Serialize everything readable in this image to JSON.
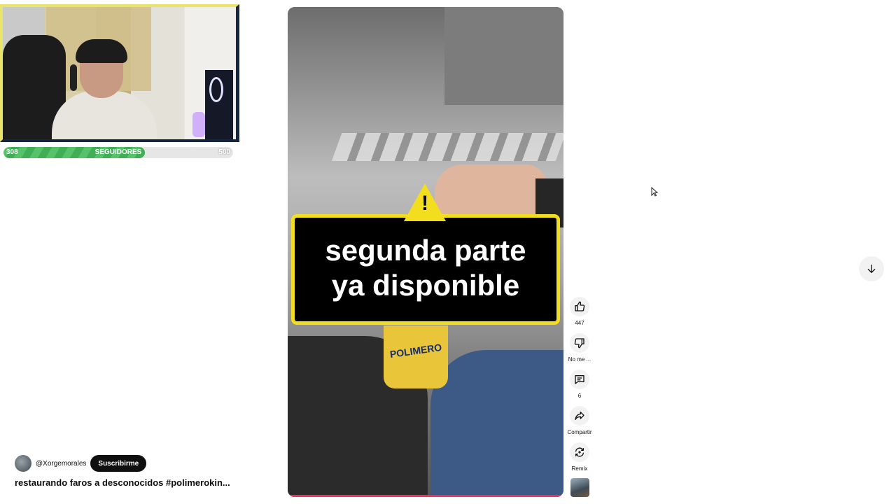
{
  "follower_goal": {
    "current": "308",
    "label": "SEGUIDORES",
    "target": "500",
    "progress_fraction": 0.616,
    "fill_color": "#4cb862"
  },
  "video": {
    "banner_line1": "segunda parte",
    "banner_line2": "ya disponible",
    "can_text": "POLIMERO",
    "progress_color": "#ff2d55"
  },
  "channel": {
    "handle": "@Xorgemorales",
    "subscribe_label": "Suscribirme",
    "title": "restaurando faros a desconocidos #polimerokin..."
  },
  "actions": {
    "like_count": "447",
    "dislike_label": "No me ...",
    "comment_count": "6",
    "share_label": "Compartir",
    "remix_label": "Remix"
  },
  "icons": [
    "thumbs-up-icon",
    "thumbs-down-icon",
    "comment-icon",
    "share-icon",
    "remix-icon",
    "arrow-down-icon",
    "cursor-icon"
  ]
}
